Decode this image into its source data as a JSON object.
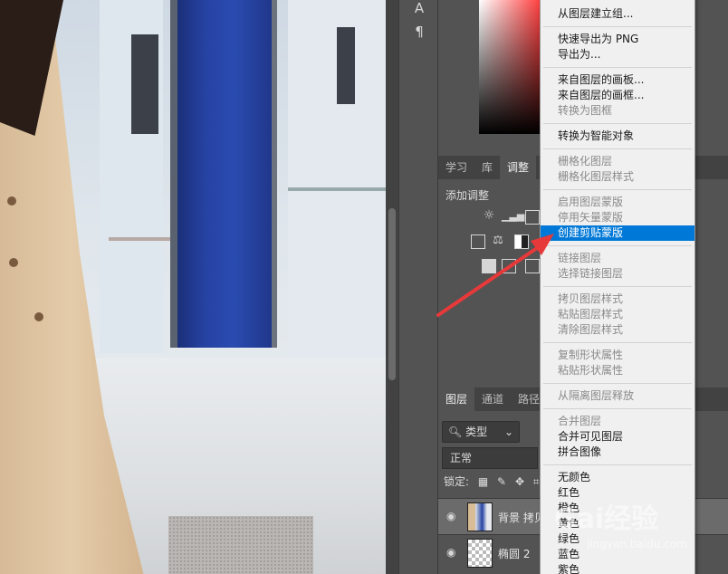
{
  "panel": {
    "tabs_top": [
      "学习",
      "库",
      "调整"
    ],
    "adjust_label": "添加调整",
    "tabs_layers": [
      "图层",
      "通道",
      "路径"
    ],
    "search": "类型",
    "blend": "正常",
    "lock_label": "锁定:",
    "layers": [
      {
        "name": "背景 拷贝",
        "selected": true
      },
      {
        "name": "椭圆 2",
        "selected": false
      }
    ]
  },
  "toolstrip": {
    "icons": [
      "type-icon",
      "paragraph-icon"
    ]
  },
  "context_menu": {
    "groups": [
      [
        {
          "label": "从图层建立组...",
          "enabled": true
        }
      ],
      [
        {
          "label": "快速导出为 PNG",
          "enabled": true
        },
        {
          "label": "导出为...",
          "enabled": true
        }
      ],
      [
        {
          "label": "来自图层的画板...",
          "enabled": true
        },
        {
          "label": "来自图层的画框...",
          "enabled": true
        },
        {
          "label": "转换为图框",
          "enabled": false
        }
      ],
      [
        {
          "label": "转换为智能对象",
          "enabled": true
        }
      ],
      [
        {
          "label": "栅格化图层",
          "enabled": false
        },
        {
          "label": "栅格化图层样式",
          "enabled": false
        }
      ],
      [
        {
          "label": "启用图层蒙版",
          "enabled": false
        },
        {
          "label": "停用矢量蒙版",
          "enabled": false
        },
        {
          "label": "创建剪贴蒙版",
          "enabled": true,
          "highlighted": true
        }
      ],
      [
        {
          "label": "链接图层",
          "enabled": false
        },
        {
          "label": "选择链接图层",
          "enabled": false
        }
      ],
      [
        {
          "label": "拷贝图层样式",
          "enabled": false
        },
        {
          "label": "粘贴图层样式",
          "enabled": false
        },
        {
          "label": "清除图层样式",
          "enabled": false
        }
      ],
      [
        {
          "label": "复制形状属性",
          "enabled": false
        },
        {
          "label": "粘贴形状属性",
          "enabled": false
        }
      ],
      [
        {
          "label": "从隔离图层释放",
          "enabled": false
        }
      ],
      [
        {
          "label": "合并图层",
          "enabled": false
        },
        {
          "label": "合并可见图层",
          "enabled": true
        },
        {
          "label": "拼合图像",
          "enabled": true
        }
      ],
      [
        {
          "label": "无颜色",
          "enabled": true
        },
        {
          "label": "红色",
          "enabled": true
        },
        {
          "label": "橙色",
          "enabled": true
        },
        {
          "label": "黄色",
          "enabled": true
        },
        {
          "label": "绿色",
          "enabled": true
        },
        {
          "label": "蓝色",
          "enabled": true
        },
        {
          "label": "紫色",
          "enabled": true
        }
      ]
    ]
  },
  "watermark": {
    "text": "Gai经验",
    "sub": "jingyan.baidu.com"
  },
  "colors": {
    "highlight": "#0078d7",
    "arrow": "#e8393a"
  }
}
